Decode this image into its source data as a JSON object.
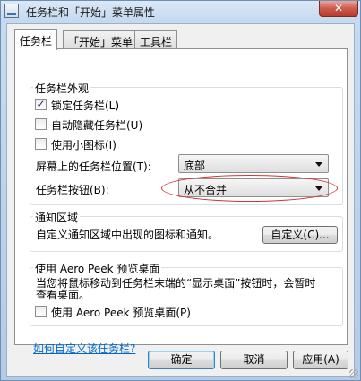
{
  "window": {
    "title": "任务栏和「开始」菜单属性",
    "close_label": "✕"
  },
  "tabs": [
    {
      "label": "任务栏",
      "active": true
    },
    {
      "label": "「开始」菜单",
      "active": false
    },
    {
      "label": "工具栏",
      "active": false
    }
  ],
  "appearance": {
    "title": "任务栏外观",
    "lock_taskbar": {
      "label": "锁定任务栏(L)",
      "checked": true
    },
    "autohide": {
      "label": "自动隐藏任务栏(U)",
      "checked": false
    },
    "small_icons": {
      "label": "使用小图标(I)",
      "checked": false
    },
    "location_label": "屏幕上的任务栏位置(T):",
    "location_value": "底部",
    "buttons_label": "任务栏按钮(B):",
    "buttons_value": "从不合并"
  },
  "notification": {
    "title": "通知区域",
    "description": "自定义通知区域中出现的图标和通知。",
    "customize_button": "自定义(C)..."
  },
  "aero_peek": {
    "title": "使用 Aero Peek 预览桌面",
    "description_line1": "当您将鼠标移动到任务栏末端的“显示桌面”按钮时，会暂时",
    "description_line2": "查看桌面。",
    "checkbox": {
      "label": "使用 Aero Peek 预览桌面(P)",
      "checked": false
    }
  },
  "help_link": "如何自定义该任务栏?",
  "buttons": {
    "ok": "确定",
    "cancel": "取消",
    "apply": "应用(A)"
  },
  "colors": {
    "accent_link": "#0066cc",
    "annotation_ellipse": "#d23232"
  }
}
